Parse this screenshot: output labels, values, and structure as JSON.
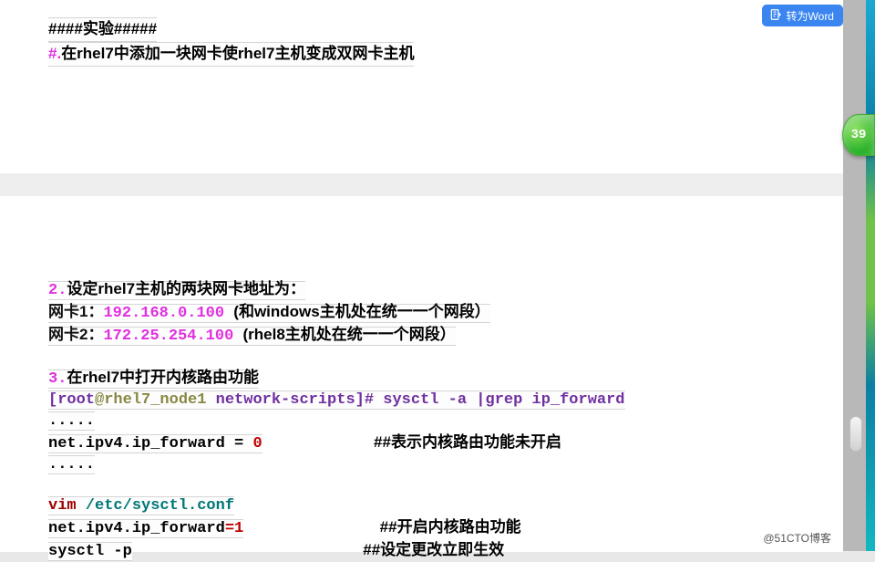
{
  "word_btn": "转为Word",
  "badge": "39",
  "watermark": "@51CTO博客",
  "top": {
    "l1": "####实验#####",
    "l2a": "#.",
    "l2b": "在rhel7中添加一块网卡使rhel7主机变成双网卡主机"
  },
  "bottom": {
    "l1a": "2.",
    "l1b": "设定rhel7主机的两块网卡地址为：",
    "l2a": "网卡1：",
    "l2b": "192.168.0.100 ",
    "l2c": "(和windows主机处在统一一个网段）",
    "l3a": "网卡2：",
    "l3b": "172.25.254.100 ",
    "l3c": "(rhel8主机处在统一一个网段）",
    "l4a": "3.",
    "l4b": "在rhel7中打开内核路由功能",
    "l5a": "[root",
    "l5b": "@rhel7_node1",
    "l5c": " network-scripts]# sysctl -a  |grep ip_forward",
    "l6": ".....",
    "l7a": "net.ipv4.ip_forward = ",
    "l7b": "0",
    "l7c": "##表示内核路由功能未开启",
    "l8": ".....",
    "l9a": "vim",
    "l9b": " /etc/sysctl.conf",
    "l10a": "net.ipv4.ip_forward",
    "l10b": "=",
    "l10c": "1",
    "l10d": "##开启内核路由功能",
    "l11a": "sysctl -p",
    "l11b": "##设定更改立即生效"
  }
}
